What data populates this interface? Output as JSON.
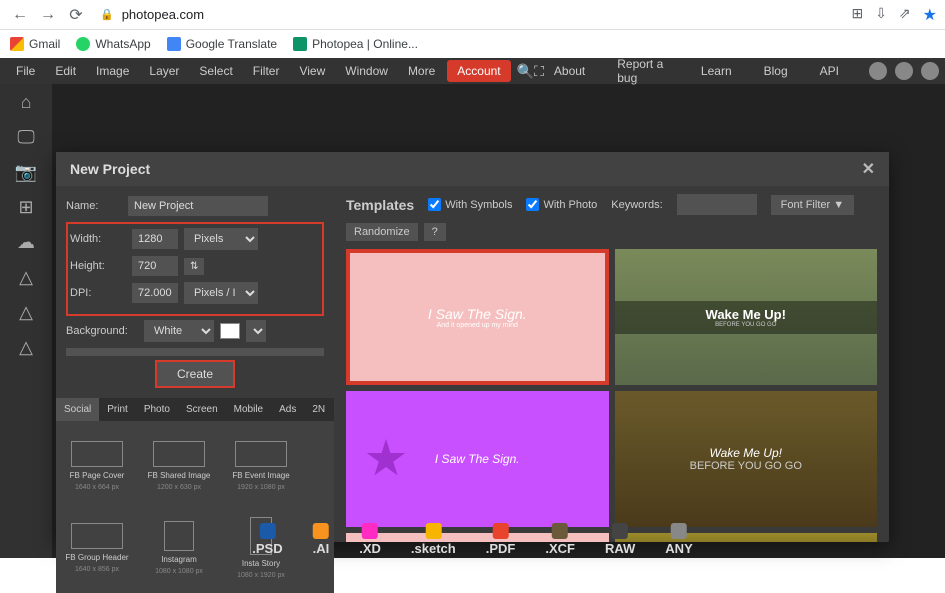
{
  "browser": {
    "url": "photopea.com"
  },
  "bookmarks": [
    {
      "label": "Gmail"
    },
    {
      "label": "WhatsApp"
    },
    {
      "label": "Google Translate"
    },
    {
      "label": "Photopea | Online..."
    }
  ],
  "menubar": {
    "items": [
      "File",
      "Edit",
      "Image",
      "Layer",
      "Select",
      "Filter",
      "View",
      "Window",
      "More"
    ],
    "account": "Account",
    "right": [
      "About",
      "Report a bug",
      "Learn",
      "Blog",
      "API"
    ]
  },
  "modal": {
    "title": "New Project",
    "name_label": "Name:",
    "name_value": "New Project",
    "width_label": "Width:",
    "width_value": "1280",
    "width_unit": "Pixels",
    "height_label": "Height:",
    "height_value": "720",
    "dpi_label": "DPI:",
    "dpi_value": "72.000",
    "dpi_unit": "Pixels / Inch",
    "bg_label": "Background:",
    "bg_value": "White",
    "create": "Create",
    "tabs": [
      "Social",
      "Print",
      "Photo",
      "Screen",
      "Mobile",
      "Ads",
      "2N"
    ],
    "presets": [
      {
        "name": "FB Page Cover",
        "size": "1640 x 664 px",
        "shape": "wide"
      },
      {
        "name": "FB Shared Image",
        "size": "1200 x 630 px",
        "shape": "wide"
      },
      {
        "name": "FB Event Image",
        "size": "1920 x 1080 px",
        "shape": "wide"
      },
      {
        "name": "FB Group Header",
        "size": "1640 x 856 px",
        "shape": "wide"
      },
      {
        "name": "Instagram",
        "size": "1080 x 1080 px",
        "shape": "sq"
      },
      {
        "name": "Insta Story",
        "size": "1080 x 1920 px",
        "shape": "tall"
      }
    ]
  },
  "templates": {
    "title": "Templates",
    "with_symbols": "With Symbols",
    "with_photo": "With Photo",
    "keywords": "Keywords:",
    "font_filter": "Font Filter ▼",
    "randomize": "Randomize",
    "help": "?",
    "items": [
      {
        "txt": "I Saw The Sign.",
        "sub": "And it opened up my mind"
      },
      {
        "txt": "Wake Me Up!",
        "sub": "BEFORE YOU GO GO"
      },
      {
        "txt": "I Saw The Sign.",
        "sub": ""
      },
      {
        "txt": "Wake Me Up!",
        "sub": "BEFORE YOU GO GO"
      }
    ]
  },
  "footer": [
    ".PSD",
    ".AI",
    ".XD",
    ".sketch",
    ".PDF",
    ".XCF",
    "RAW",
    "ANY"
  ]
}
